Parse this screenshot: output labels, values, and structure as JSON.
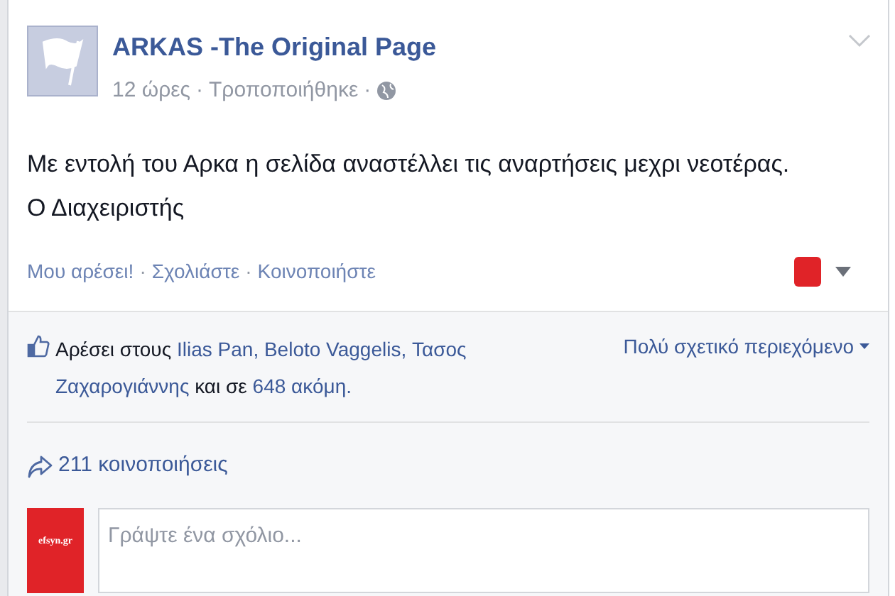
{
  "post": {
    "page_name": "ARKAS -The Original Page",
    "time": "12 ώρες",
    "separator": "·",
    "edited": "Τροποποιήθηκε",
    "body_lines": [
      "Με εντολή του Αρκα η σελίδα αναστέλλει τις αναρτήσεις μεχρι νεοτέρας.",
      "Ο Διαχειριστής"
    ],
    "actions": [
      "Μου αρέσει!",
      "·",
      "Σχολιάστε",
      "·",
      "Κοινοποιήστε"
    ]
  },
  "likes": {
    "segments": [
      {
        "kind": "text",
        "text": "Αρέσει στους "
      },
      {
        "kind": "link",
        "text": "Ilias Pan"
      },
      {
        "kind": "punct",
        "text": ", "
      },
      {
        "kind": "link",
        "text": "Beloto Vaggelis"
      },
      {
        "kind": "punct",
        "text": ", "
      },
      {
        "kind": "link",
        "text": "Τασος",
        "space_after": true
      },
      {
        "kind": "link",
        "text": "Ζαχαρογιάννης"
      },
      {
        "kind": "text",
        "text": " και σε "
      },
      {
        "kind": "link",
        "text": "648 ακόμη."
      }
    ],
    "sort": "Πολύ σχετικό περιεχόμενο"
  },
  "shares": "211 κοινοποιήσεις",
  "comment": {
    "avatar_text": "efsyn.gr",
    "placeholder": "Γράψτε ένα σχόλιο..."
  }
}
